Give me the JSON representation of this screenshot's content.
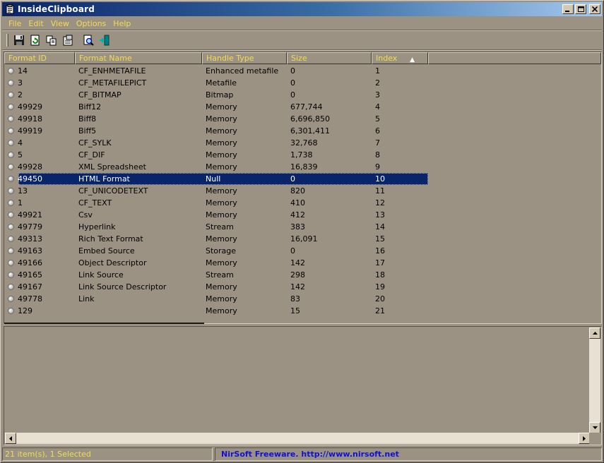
{
  "window": {
    "title": "InsideClipboard",
    "minimize_label": "_",
    "maximize_label": "□",
    "close_label": "×"
  },
  "menu": {
    "items": [
      {
        "label": "File"
      },
      {
        "label": "Edit"
      },
      {
        "label": "View"
      },
      {
        "label": "Options"
      },
      {
        "label": "Help"
      }
    ]
  },
  "toolbar": {
    "buttons": [
      {
        "icon": "save-icon"
      },
      {
        "icon": "refresh-icon"
      },
      {
        "icon": "copy-icon"
      },
      {
        "icon": "properties-icon"
      },
      {
        "icon": "find-icon"
      },
      {
        "icon": "exit-icon"
      }
    ]
  },
  "list": {
    "columns": [
      {
        "label": "Format ID"
      },
      {
        "label": "Format Name"
      },
      {
        "label": "Handle Type"
      },
      {
        "label": "Size"
      },
      {
        "label": "Index"
      }
    ],
    "sort_column": "Index",
    "rows": [
      {
        "id": "14",
        "name": "CF_ENHMETAFILE",
        "handle": "Enhanced metafile",
        "size": "0",
        "index": "1"
      },
      {
        "id": "3",
        "name": "CF_METAFILEPICT",
        "handle": "Metafile",
        "size": "0",
        "index": "2"
      },
      {
        "id": "2",
        "name": "CF_BITMAP",
        "handle": "Bitmap",
        "size": "0",
        "index": "3"
      },
      {
        "id": "49929",
        "name": "Biff12",
        "handle": "Memory",
        "size": "677,744",
        "index": "4"
      },
      {
        "id": "49918",
        "name": "Biff8",
        "handle": "Memory",
        "size": "6,696,850",
        "index": "5"
      },
      {
        "id": "49919",
        "name": "Biff5",
        "handle": "Memory",
        "size": "6,301,411",
        "index": "6"
      },
      {
        "id": "4",
        "name": "CF_SYLK",
        "handle": "Memory",
        "size": "32,768",
        "index": "7"
      },
      {
        "id": "5",
        "name": "CF_DIF",
        "handle": "Memory",
        "size": "1,738",
        "index": "8"
      },
      {
        "id": "49928",
        "name": "XML Spreadsheet",
        "handle": "Memory",
        "size": "16,839",
        "index": "9"
      },
      {
        "id": "49450",
        "name": "HTML Format",
        "handle": "Null",
        "size": "0",
        "index": "10",
        "selected": true
      },
      {
        "id": "13",
        "name": "CF_UNICODETEXT",
        "handle": "Memory",
        "size": "820",
        "index": "11"
      },
      {
        "id": "1",
        "name": "CF_TEXT",
        "handle": "Memory",
        "size": "410",
        "index": "12"
      },
      {
        "id": "49921",
        "name": "Csv",
        "handle": "Memory",
        "size": "412",
        "index": "13"
      },
      {
        "id": "49779",
        "name": "Hyperlink",
        "handle": "Stream",
        "size": "383",
        "index": "14"
      },
      {
        "id": "49313",
        "name": "Rich Text Format",
        "handle": "Memory",
        "size": "16,091",
        "index": "15"
      },
      {
        "id": "49163",
        "name": "Embed Source",
        "handle": "Storage",
        "size": "0",
        "index": "16"
      },
      {
        "id": "49166",
        "name": "Object Descriptor",
        "handle": "Memory",
        "size": "142",
        "index": "17"
      },
      {
        "id": "49165",
        "name": "Link Source",
        "handle": "Stream",
        "size": "298",
        "index": "18"
      },
      {
        "id": "49167",
        "name": "Link Source Descriptor",
        "handle": "Memory",
        "size": "142",
        "index": "19"
      },
      {
        "id": "49778",
        "name": "Link",
        "handle": "Memory",
        "size": "83",
        "index": "20"
      },
      {
        "id": "129",
        "name": "",
        "handle": "Memory",
        "size": "15",
        "index": "21"
      }
    ]
  },
  "status": {
    "items": "21 item(s), 1 Selected",
    "credit": "NirSoft Freeware.  http://www.nirsoft.net"
  },
  "colors": {
    "background": "#9c9284",
    "header_text": "#f0dc50",
    "selection": "#0a246a",
    "credit_text": "#1010d8"
  }
}
